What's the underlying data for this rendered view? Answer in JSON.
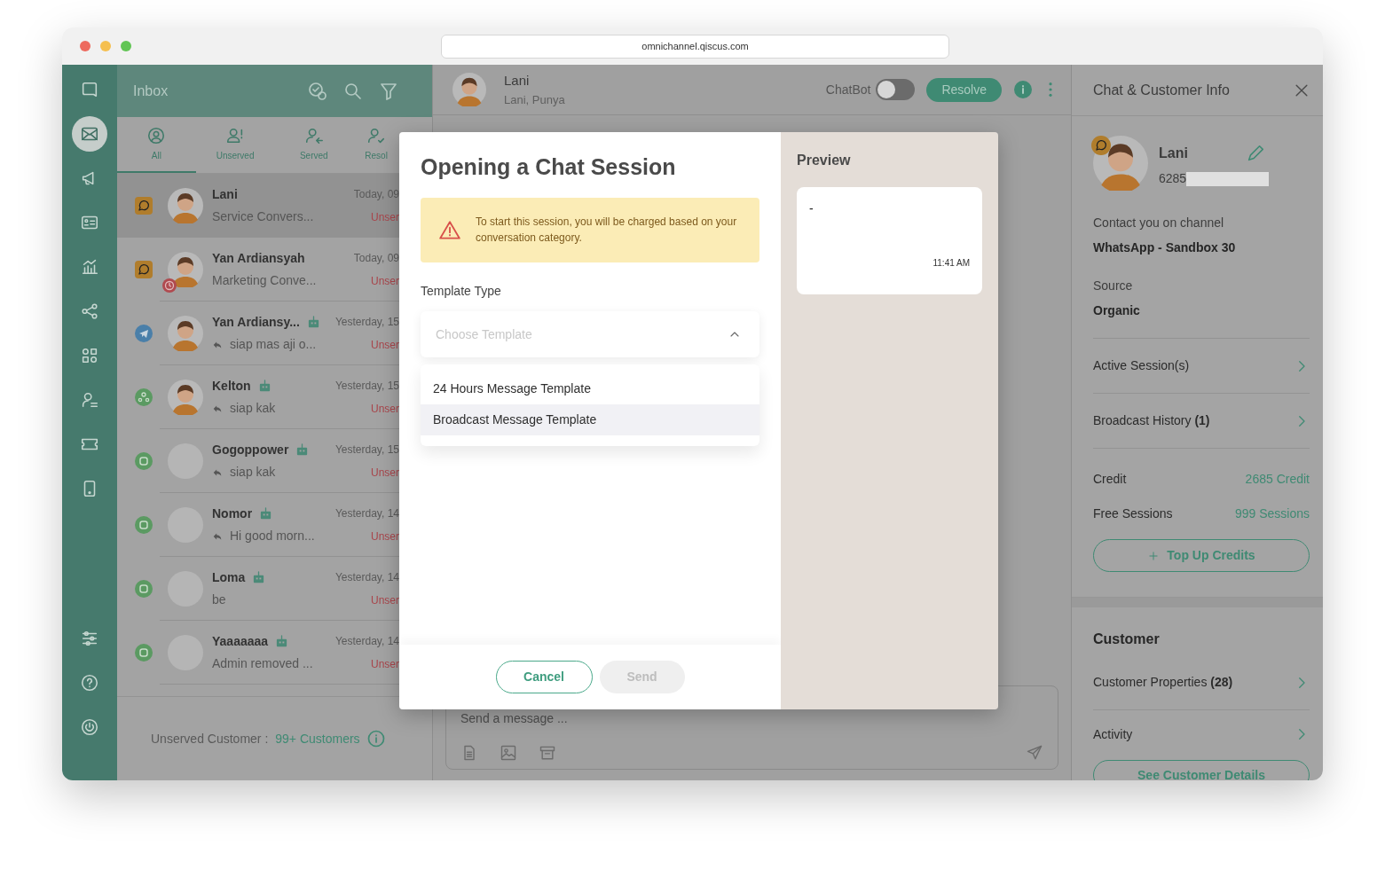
{
  "browser": {
    "url": "omnichannel.qiscus.com"
  },
  "nav_rail": {
    "top": [
      {
        "selected": false
      },
      {
        "selected": true
      },
      {
        "selected": false
      },
      {
        "selected": false
      },
      {
        "selected": false
      },
      {
        "selected": false
      },
      {
        "selected": false
      },
      {
        "selected": false
      },
      {
        "selected": false
      },
      {
        "selected": false
      }
    ],
    "bottom": [
      {
        "selected": false
      },
      {
        "selected": false
      },
      {
        "selected": false
      }
    ]
  },
  "inbox": {
    "title": "Inbox",
    "tabs": [
      {
        "label": "All",
        "selected": true
      },
      {
        "label": "Unserved",
        "selected": false
      },
      {
        "label": "Served",
        "selected": false
      },
      {
        "label": "Resol",
        "selected": false
      }
    ],
    "conversations": [
      {
        "name": "Lani",
        "preview": "Service Convers...",
        "time": "Today, 09",
        "status": "Unser",
        "channel": {
          "kind": "whatsapp"
        },
        "avatar_photo": true,
        "bot": false,
        "replied": false,
        "overdue": false,
        "selected": true
      },
      {
        "name": "Yan Ardiansyah",
        "preview": "Marketing Conve...",
        "time": "Today, 09",
        "status": "Unser",
        "channel": {
          "kind": "whatsapp"
        },
        "avatar_photo": true,
        "bot": false,
        "replied": false,
        "overdue": true,
        "selected": false
      },
      {
        "name": "Yan Ardiansy...",
        "preview": "siap mas aji o...",
        "time": "Yesterday, 15",
        "status": "Unser",
        "channel": {
          "kind": "telegram"
        },
        "avatar_photo": true,
        "bot": true,
        "replied": true,
        "overdue": false,
        "selected": false
      },
      {
        "name": "Kelton",
        "preview": "siap kak",
        "time": "Yesterday, 15",
        "status": "Unser",
        "channel": {
          "kind": "custom"
        },
        "avatar_photo": true,
        "bot": true,
        "replied": true,
        "overdue": false,
        "selected": false
      },
      {
        "name": "Gogoppower",
        "preview": "siap kak",
        "time": "Yesterday, 15",
        "status": "Unser",
        "channel": {
          "kind": "qiscus"
        },
        "avatar_photo": false,
        "bot": true,
        "replied": true,
        "overdue": false,
        "selected": false
      },
      {
        "name": "Nomor",
        "preview": "Hi good morn...",
        "time": "Yesterday, 14",
        "status": "Unser",
        "channel": {
          "kind": "qiscus"
        },
        "avatar_photo": false,
        "bot": true,
        "replied": true,
        "overdue": false,
        "selected": false
      },
      {
        "name": "Loma",
        "preview": "be",
        "time": "Yesterday, 14",
        "status": "Unser",
        "channel": {
          "kind": "qiscus"
        },
        "avatar_photo": false,
        "bot": true,
        "replied": false,
        "overdue": false,
        "selected": false
      },
      {
        "name": "Yaaaaaaa",
        "preview": "Admin removed ...",
        "time": "Yesterday, 14",
        "status": "Unser",
        "channel": {
          "kind": "qiscus"
        },
        "avatar_photo": false,
        "bot": true,
        "replied": false,
        "overdue": false,
        "selected": false
      }
    ],
    "footer": {
      "label": "Unserved Customer :",
      "count": "99+ Customers"
    }
  },
  "chat_header": {
    "name": "Lani",
    "subtitle": "Lani, Punya",
    "chatbot": {
      "label": "ChatBot",
      "on": false
    },
    "resolve": "Resolve"
  },
  "composer": {
    "placeholder": "Send a message ..."
  },
  "modal": {
    "title": "Opening a Chat Session",
    "warning": "To start this session, you will be charged based on your conversation category.",
    "field_label": "Template Type",
    "select": {
      "placeholder": "Choose Template",
      "expanded": true
    },
    "options": [
      {
        "label": "24 Hours Message Template",
        "selected": false
      },
      {
        "label": "Broadcast Message Template",
        "selected": true
      }
    ],
    "cancel": "Cancel",
    "send": {
      "label": "Send",
      "disabled": true
    },
    "preview": {
      "title": "Preview",
      "message": "-",
      "time": "11:41 AM"
    }
  },
  "info": {
    "title": "Chat & Customer Info",
    "name": "Lani",
    "phone": "6285",
    "channel_label": "Contact you on channel",
    "channel": "WhatsApp - Sandbox 30",
    "source_label": "Source",
    "source": "Organic",
    "links": [
      {
        "label": "Active Session(s)"
      },
      {
        "label": "Broadcast History **(1)**"
      }
    ],
    "stats": [
      {
        "label": "Credit",
        "value": "2685 Credit"
      },
      {
        "label": "Free Sessions",
        "value": "999 Sessions"
      }
    ],
    "top_up": "Top Up Credits",
    "customer": {
      "title": "Customer",
      "links": [
        {
          "label": "Customer Properties **(28)**"
        },
        {
          "label": "Activity"
        }
      ],
      "details_button": "See Customer Details"
    }
  }
}
